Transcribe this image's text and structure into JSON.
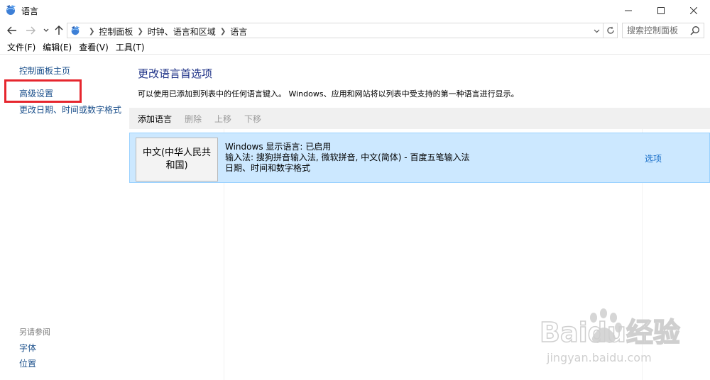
{
  "window": {
    "title": "语言",
    "icon": "language-globe-icon"
  },
  "address": {
    "crumbs": [
      "控制面板",
      "时钟、语言和区域",
      "语言"
    ],
    "search_placeholder": "搜索控制面板"
  },
  "menu": {
    "items": [
      "文件(F)",
      "编辑(E)",
      "查看(V)",
      "工具(T)"
    ]
  },
  "sidebar": {
    "home": "控制面板主页",
    "advanced": "高级设置",
    "date_format": "更改日期、时间或数字格式",
    "see_also": "另请参阅",
    "fonts": "字体",
    "location": "位置"
  },
  "main": {
    "title": "更改语言首选项",
    "description": "可以使用已添加到列表中的任何语言键入。 Windows、应用和网站将以列表中受支持的第一种语言进行显示。",
    "toolbar": {
      "add": "添加语言",
      "remove": "删除",
      "move_up": "上移",
      "move_down": "下移"
    },
    "languages": [
      {
        "name": "中文(中华人民共和国)",
        "line1": "Windows 显示语言: 已启用",
        "line2": "输入法: 搜狗拼音输入法, 微软拼音, 中文(简体) - 百度五笔输入法",
        "line3": "日期、时间和数字格式",
        "options": "选项"
      }
    ]
  },
  "watermark": {
    "text": "Baidu经验",
    "url": "jingyan.baidu.com"
  },
  "colors": {
    "link": "#1a4f8b",
    "title": "#1e3287",
    "selection": "#cce8ff",
    "highlight_box": "#e6262e"
  }
}
